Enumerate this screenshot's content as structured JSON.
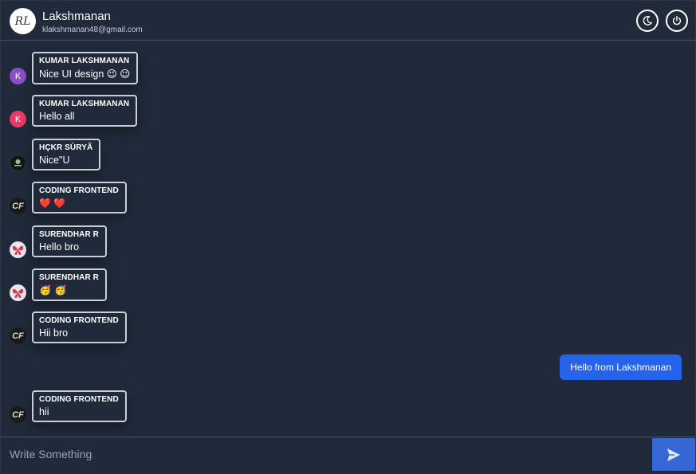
{
  "header": {
    "avatar_text": "RL",
    "user_name": "Lakshmanan",
    "user_email": "klakshmanan48@gmail.com",
    "theme_icon": "moon-icon",
    "power_icon": "power-icon"
  },
  "messages": [
    {
      "sender": "KUMAR LAKSHMANAN",
      "text": "Nice UI design 😉 😉",
      "avatar": "K",
      "avatar_color": "#8a4fc8"
    },
    {
      "sender": "KUMAR LAKSHMANAN",
      "text": "Hello all",
      "avatar": "K",
      "avatar_color": "#e8396b"
    },
    {
      "sender": "HÇKR SÙRYÃ",
      "text": "Nice\"U",
      "avatar": "",
      "avatar_color": "#0b1a12"
    },
    {
      "sender": "CODING FRONTEND",
      "text": "❤️ ❤️",
      "avatar": "CF",
      "avatar_color": "#1a1a1a"
    },
    {
      "sender": "SURENDHAR R",
      "text": "Hello bro",
      "avatar": "",
      "avatar_color": "#d9395f"
    },
    {
      "sender": "SURENDHAR R",
      "text": "🥳 🥳",
      "avatar": "",
      "avatar_color": "#d9395f"
    },
    {
      "sender": "CODING FRONTEND",
      "text": "Hii bro",
      "avatar": "CF",
      "avatar_color": "#1a1a1a"
    },
    {
      "sender": "CODING FRONTEND",
      "text": "hii",
      "avatar": "CF",
      "avatar_color": "#1a1a1a"
    }
  ],
  "own_message": {
    "text": "Hello from Lakshmanan"
  },
  "composer": {
    "placeholder": "Write Something",
    "send_icon": "send-icon"
  },
  "colors": {
    "background": "#202a3a",
    "accent": "#2563eb",
    "send_button": "#3568d4"
  }
}
